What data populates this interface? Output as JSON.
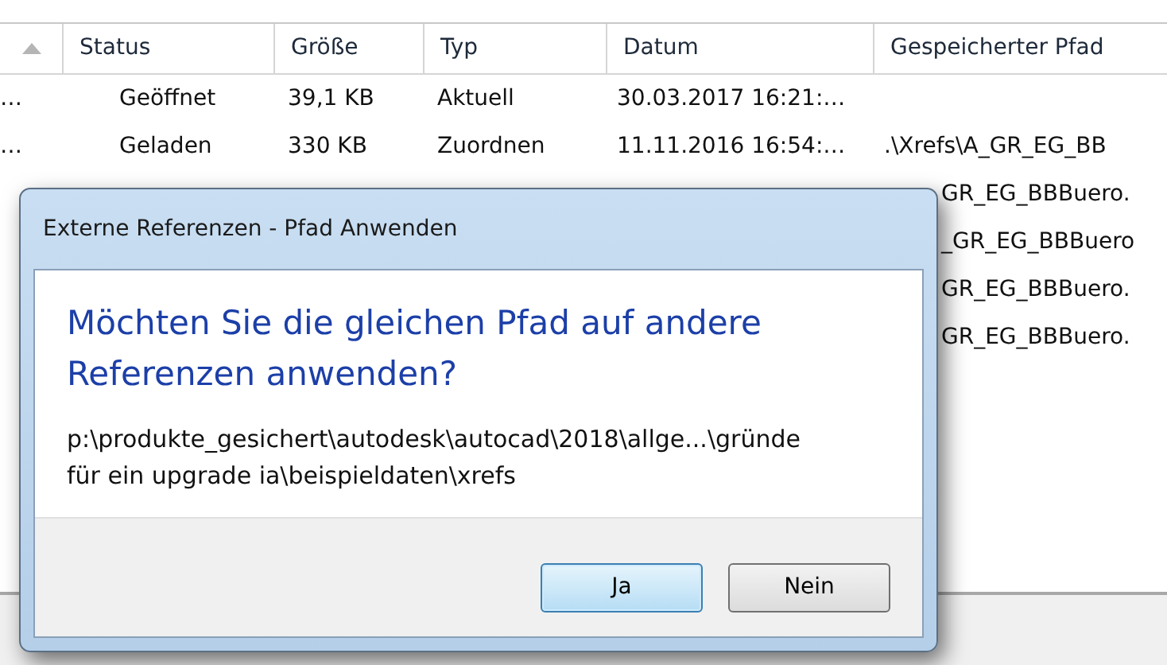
{
  "table": {
    "sort_ascending": true,
    "columns": [
      "Status",
      "Größe",
      "Typ",
      "Datum",
      "Gespeicherter Pfad"
    ],
    "rows": [
      {
        "column_1": "…",
        "status": "Geöffnet",
        "size": "39,1 KB",
        "type": "Aktuell",
        "date": "30.03.2017 16:21:…",
        "path": ""
      },
      {
        "column_1": "…",
        "status": "Geladen",
        "size": "330 KB",
        "type": "Zuordnen",
        "date": "11.11.2016 16:54:…",
        "path": ".\\Xrefs\\A_GR_EG_BB"
      },
      {
        "path": "GR_EG_BBBuero."
      },
      {
        "path": "_GR_EG_BBBuero"
      },
      {
        "path": "GR_EG_BBBuero."
      },
      {
        "path": "GR_EG_BBBuero."
      }
    ]
  },
  "dialog": {
    "title": "Externe Referenzen - Pfad Anwenden",
    "question": "Möchten Sie die gleichen Pfad auf andere Referenzen anwenden?",
    "path": "p:\\produkte_gesichert\\autodesk\\autocad\\2018\\allge...\\gründe für ein upgrade ia\\beispieldaten\\xrefs",
    "buttons": [
      {
        "label": "Ja",
        "focused": true
      },
      {
        "label": "Nein",
        "focused": false
      }
    ]
  }
}
